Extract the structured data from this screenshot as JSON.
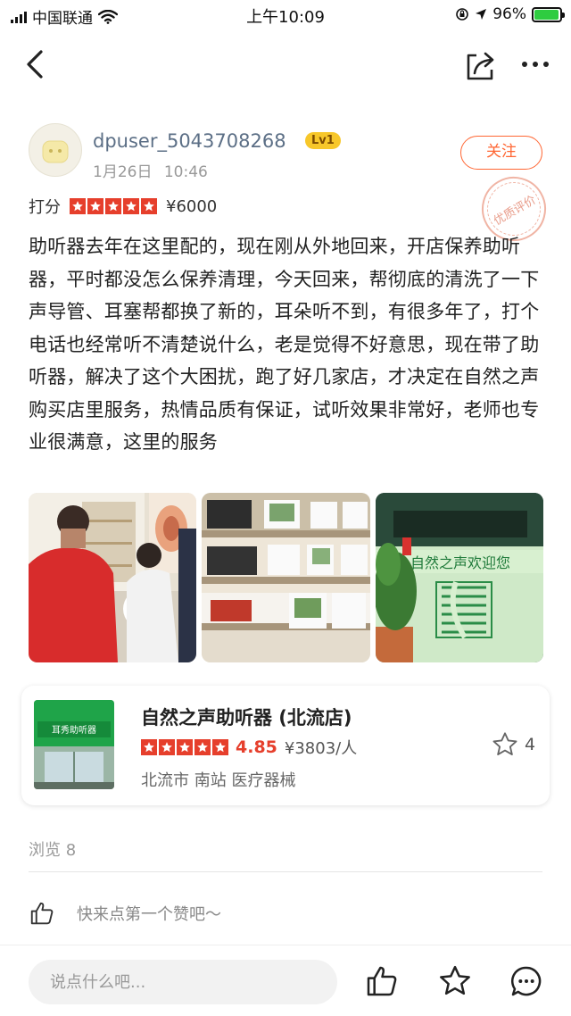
{
  "status_bar": {
    "carrier": "中国联通",
    "time": "上午10:09",
    "battery_percent": "96%",
    "battery_level": 0.96
  },
  "nav": {
    "back_icon": "chevron-left-icon",
    "share_icon": "share-icon",
    "more_icon": "more-dots-icon"
  },
  "review": {
    "username": "dpuser_5043708268",
    "level": "Lv1",
    "date": "1月26日",
    "time": "10:46",
    "follow_label": "关注",
    "quality_stamp": "优质评价",
    "rating_label": "打分",
    "stars": 5,
    "price": "¥6000",
    "text": "助听器去年在这里配的，现在刚从外地回来，开店保养助听器，平时都没怎么保养清理，今天回来，帮彻底的清洗了一下声导管、耳塞帮都换了新的，耳朵听不到，有很多年了，打个电话也经常听不清楚说什么，老是觉得不好意思，现在带了助听器，解决了这个大困扰，跑了好几家店，才决定在自然之声购买店里服务，热情品质有保证，试听效果非常好，老师也专业很满意，这里的服务"
  },
  "photos": {
    "photo3_sign": "自然之声欢迎您"
  },
  "shop": {
    "name": "自然之声助听器 (北流店)",
    "stars": 5,
    "score": "4.85",
    "price": "¥3803/人",
    "tags": "北流市 南站 医疗器械",
    "favorites": "4",
    "storefront_sign": "耳秀助听器"
  },
  "footer": {
    "views": "浏览 8",
    "like_prompt": "快来点第一个赞吧～",
    "comment_placeholder": "说点什么吧..."
  },
  "colors": {
    "accent": "#ff6633",
    "star_red": "#e63f2c",
    "level_yellow": "#f7c72a"
  }
}
